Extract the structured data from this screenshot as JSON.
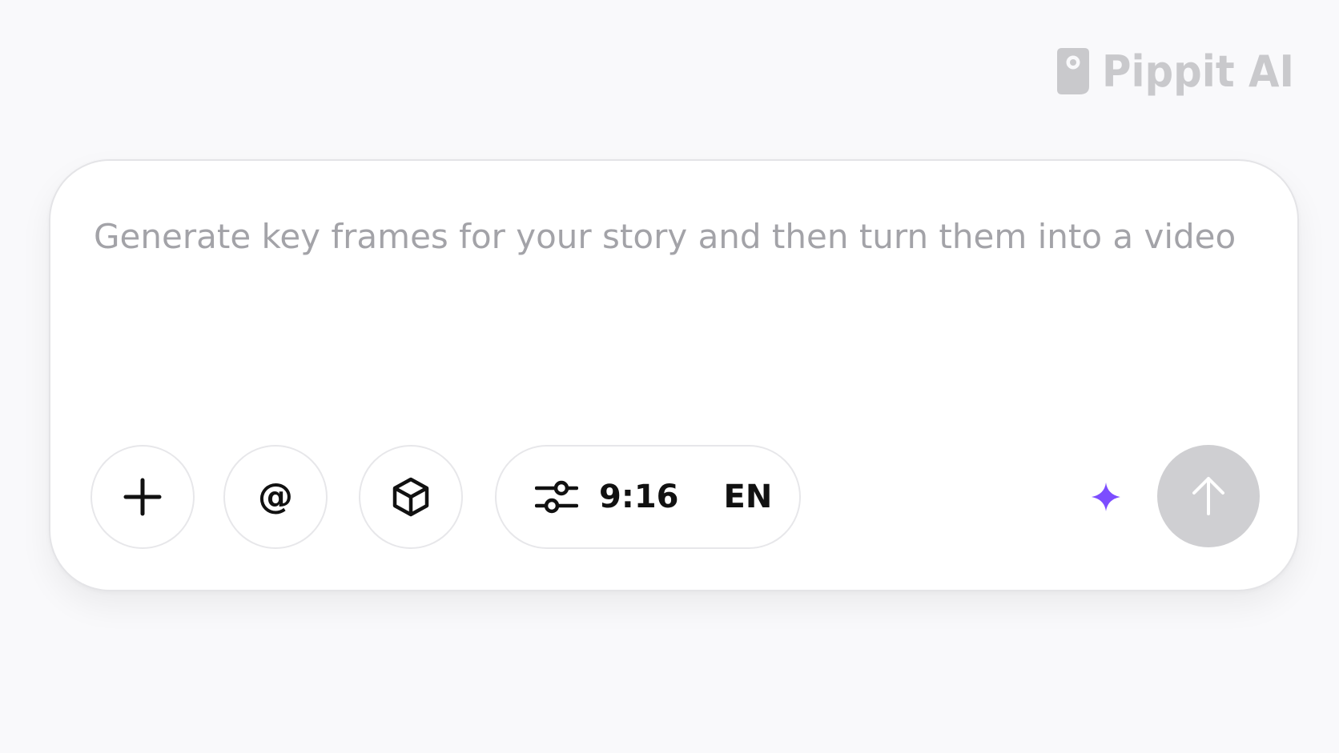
{
  "watermark": {
    "brand_text": "Pippit AI",
    "icon": "pippit-logo-icon"
  },
  "prompt": {
    "placeholder": "Generate key frames for your story and then turn them into a video",
    "value": ""
  },
  "toolbar": {
    "add_icon": "plus-icon",
    "mention_icon": "at-sign-icon",
    "mention_label": "@",
    "model_icon": "cube-icon",
    "settings_icon": "sliders-icon",
    "aspect_ratio": "9:16",
    "language": "EN",
    "enhance_icon": "sparkle-icon",
    "send_icon": "arrow-up-icon"
  },
  "colors": {
    "background": "#f9f9fb",
    "card": "#ffffff",
    "placeholder_text": "#a3a3a8",
    "accent": "#7c4dff",
    "send_disabled": "#cfcfd2",
    "watermark": "#c9c9cc"
  }
}
